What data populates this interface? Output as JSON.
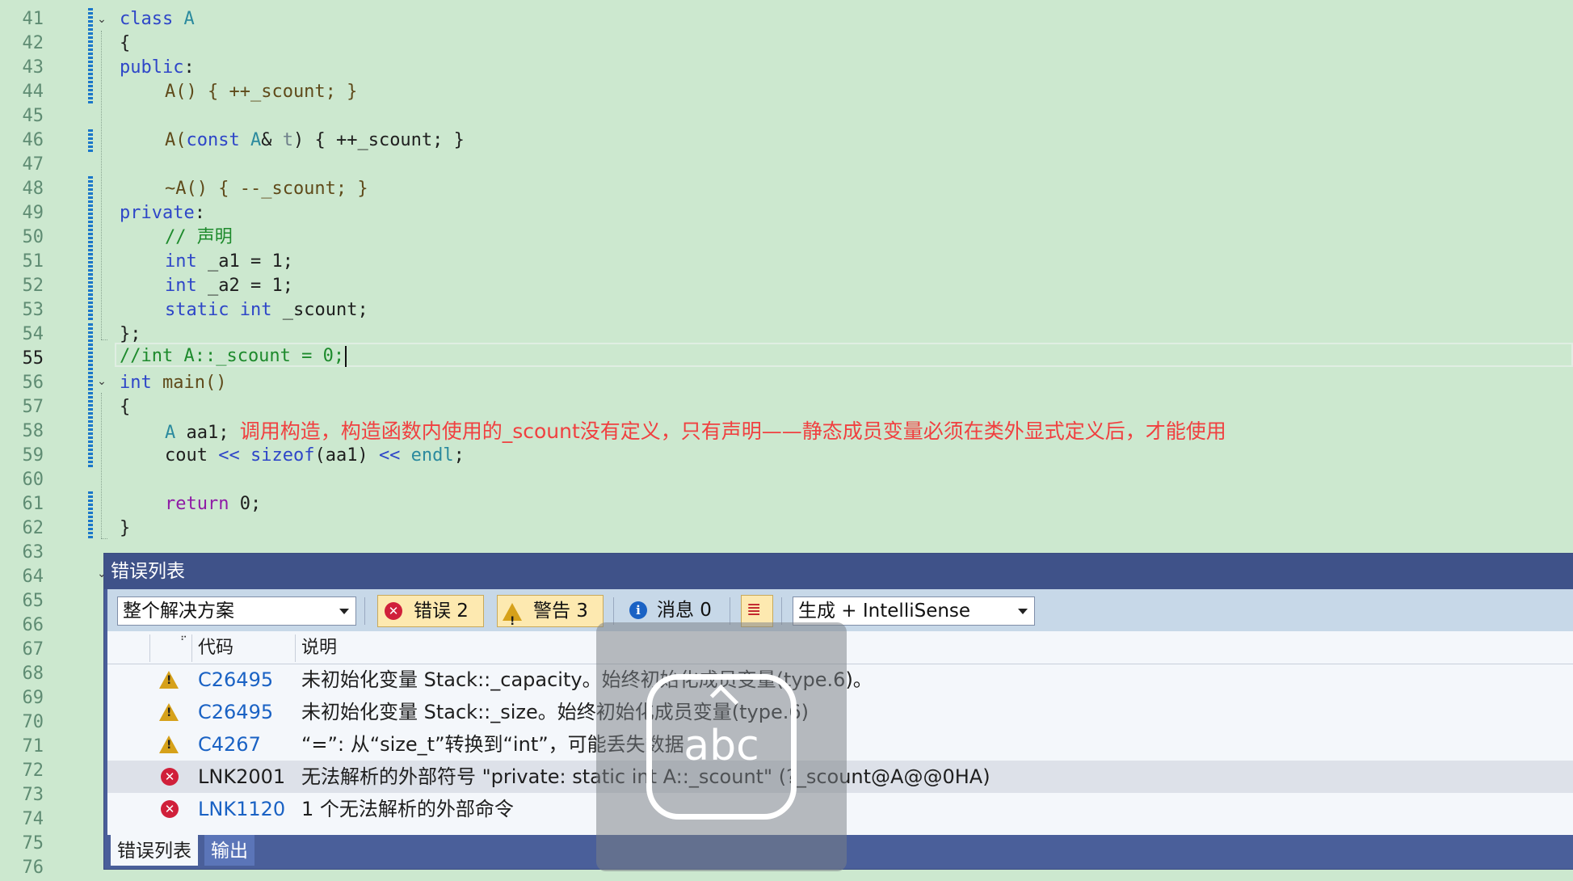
{
  "editor": {
    "line_numbers": [
      "41",
      "42",
      "43",
      "44",
      "45",
      "46",
      "47",
      "48",
      "49",
      "50",
      "51",
      "52",
      "53",
      "54",
      "55",
      "56",
      "57",
      "58",
      "59",
      "60",
      "61",
      "62",
      "63",
      "64",
      "65",
      "66",
      "67",
      "68",
      "69",
      "70",
      "71",
      "72",
      "73",
      "74",
      "75",
      "76"
    ],
    "current_line": "55",
    "code": {
      "l41": {
        "k": "class",
        "n": "A"
      },
      "l42": "{",
      "l43": {
        "k": "public",
        "p": ":"
      },
      "l44": "A() { ++_scount; }",
      "l46": {
        "a": "A(",
        "k": "const",
        "t": "A",
        "b": "& ",
        "p": "t",
        "c": ") { ++_scount; }"
      },
      "l48": "~A() { --_scount; }",
      "l49": {
        "k": "private",
        "p": ":"
      },
      "l50": "// 声明",
      "l51": {
        "k": "int",
        "r": " _a1 = 1;"
      },
      "l52": {
        "k": "int",
        "r": " _a2 = 1;"
      },
      "l53": {
        "k1": "static",
        "k2": "int",
        "r": " _scount;"
      },
      "l54": "};",
      "l55": "//int A::_scount = 0;",
      "l56": {
        "k": "int",
        "r": " main()"
      },
      "l57": "{",
      "l58": {
        "t": "A",
        "r": " aa1;",
        "note": "调用构造，构造函数内使用的_scount没有定义，只有声明——静态成员变量必须在类外显式定义后，才能使用"
      },
      "l59": {
        "a": "cout ",
        "o1": "<<",
        "f": " sizeof",
        "b": "(aa1) ",
        "o2": "<<",
        "e": " endl",
        "c": ";"
      },
      "l61": {
        "k": "return",
        "r": " 0;"
      },
      "l62": "}"
    }
  },
  "error_list": {
    "title": "错误列表",
    "scope": "整个解决方案",
    "errors_label": "错误 2",
    "warnings_label": "警告 3",
    "messages_label": "消息 0",
    "build_filter": "生成 + IntelliSense",
    "columns": {
      "code": "代码",
      "description": "说明"
    },
    "rows": [
      {
        "severity": "warning",
        "code": "C26495",
        "description": "未初始化变量 Stack::_capacity。始终初始化成员变量(type.6)。"
      },
      {
        "severity": "warning",
        "code": "C26495",
        "description": "未初始化变量 Stack::_size。始终初始化成员变量(type.6)"
      },
      {
        "severity": "warning",
        "code": "C4267",
        "description": "“=”: 从“size_t”转换到“int”，可能丢失数据"
      },
      {
        "severity": "error",
        "code": "LNK2001",
        "description": "无法解析的外部符号 \"private: static int A::_scount\" (?_scount@A@@0HA)"
      },
      {
        "severity": "error",
        "code": "LNK1120",
        "description": "1 个无法解析的外部命令"
      }
    ],
    "tabs": [
      {
        "label": "错误列表",
        "active": true
      },
      {
        "label": "输出",
        "active": false
      }
    ]
  },
  "ime_overlay": {
    "label": "abc",
    "icon": "keyboard-abc-icon"
  },
  "colors": {
    "editor_bg": "#cce8cf",
    "keyword": "#2e46c8",
    "control_keyword": "#8f1ba6",
    "type": "#2b8a9e",
    "comment": "#1d8a2c",
    "annotation": "#f04040",
    "panel_title_bg": "#3f5289",
    "toolbar_bg": "#c7d8e8"
  }
}
